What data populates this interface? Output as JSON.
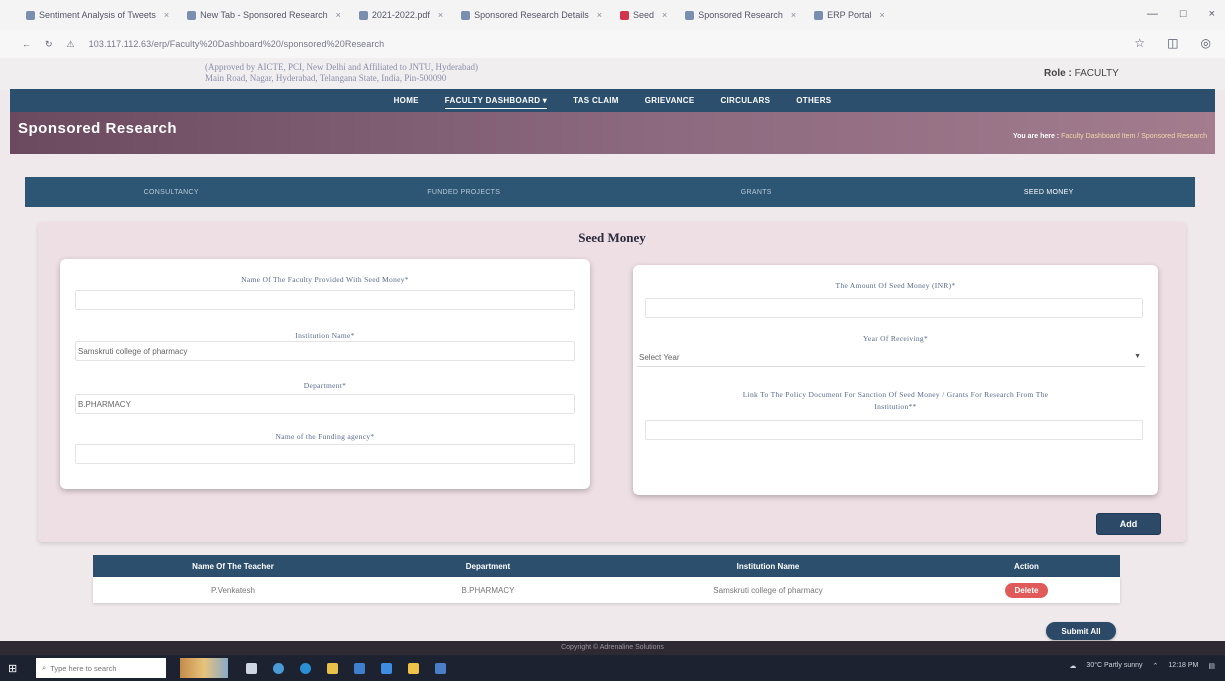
{
  "browser": {
    "tabs": [
      {
        "label": "Sentiment Analysis of Tweets"
      },
      {
        "label": "New Tab - Sponsored Research"
      },
      {
        "label": "2021-2022.pdf"
      },
      {
        "label": "Sponsored Research Details"
      },
      {
        "label": "Seed"
      },
      {
        "label": "Sponsored Research"
      },
      {
        "label": "ERP Portal"
      }
    ],
    "address": "103.117.112.63/erp/Faculty%20Dashboard%20/sponsored%20Research"
  },
  "header": {
    "blurb_line1": "(Approved by AICTE, PCI, New Delhi and Affiliated to JNTU, Hyderabad)",
    "blurb_line2": "Main Road, Nagar, Hyderabad, Telangana State, India, Pin-500090",
    "role_label": "Role :",
    "role_value": "FACULTY"
  },
  "nav": {
    "items": [
      "HOME",
      "FACULTY DASHBOARD ▾",
      "TAS CLAIM",
      "GRIEVANCE",
      "CIRCULARS",
      "OTHERS"
    ]
  },
  "banner": {
    "title": "Sponsored Research",
    "crumb_label": "You are here :",
    "crumb_path": "Faculty Dashboard Item / Sponsored Research"
  },
  "subtabs": [
    "CONSULTANCY",
    "FUNDED PROJECTS",
    "GRANTS",
    "SEED MONEY"
  ],
  "form": {
    "title": "Seed Money",
    "faculty_name_label": "Name Of The Faculty Provided With Seed Money*",
    "faculty_name_value": "",
    "institution_label": "Institution Name*",
    "institution_value": "Samskruti college of pharmacy",
    "department_label": "Department*",
    "department_value": "B.PHARMACY",
    "funding_agency_label": "Name of the Funding agency*",
    "funding_agency_value": "",
    "amount_label": "The Amount Of Seed Money (INR)*",
    "amount_value": "",
    "year_label": "Year Of Receiving*",
    "year_placeholder": "Select Year",
    "policy_label_line1": "Link To The Policy Document For Sanction Of Seed Money / Grants For Research From The",
    "policy_label_line2": "Institution**",
    "policy_value": "",
    "add_label": "Add"
  },
  "table": {
    "headers": [
      "Name Of The Teacher",
      "Department",
      "Institution Name",
      "Action"
    ],
    "rows": [
      {
        "teacher": "P.Venkatesh",
        "department": "B.PHARMACY",
        "institution": "Samskruti college of pharmacy",
        "action": "Delete"
      }
    ]
  },
  "submit_label": "Submit All",
  "footer": "Copyright © Adrenaline Solutions",
  "taskbar": {
    "search_placeholder": "Type here to search",
    "weather": "30°C Partly sunny",
    "time": "12:18 PM"
  }
}
